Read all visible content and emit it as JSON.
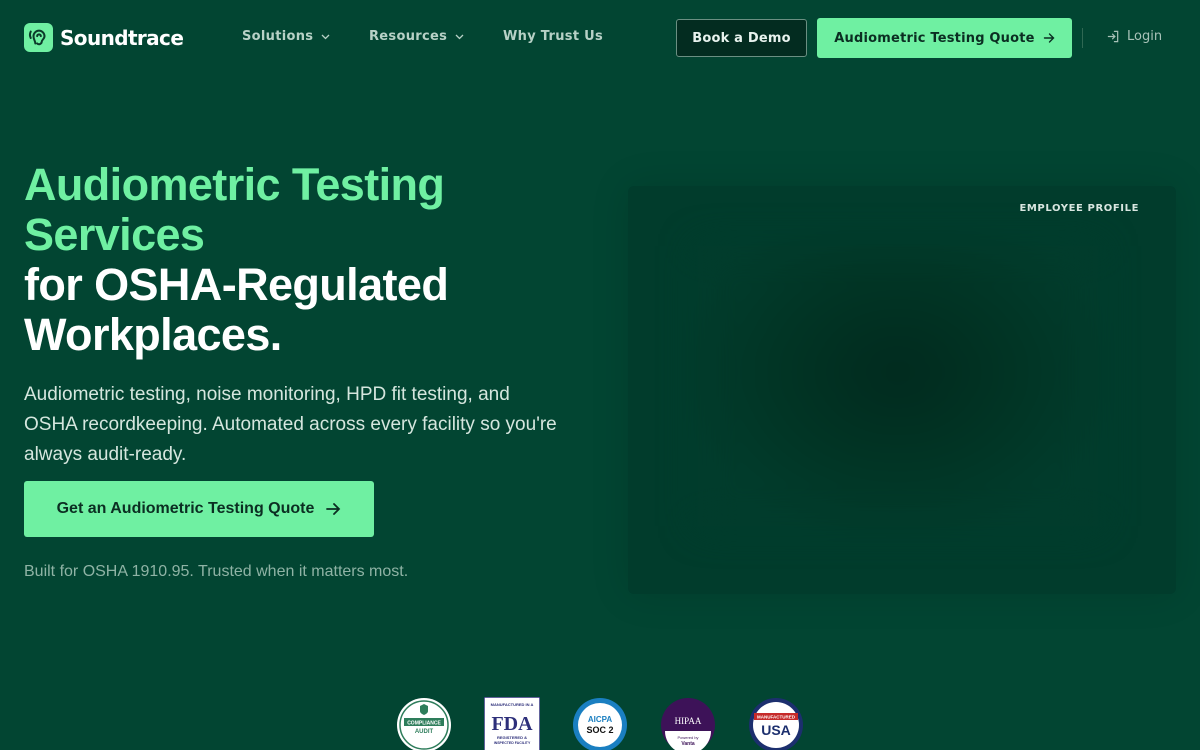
{
  "brand": {
    "name": "Soundtrace",
    "accent": "#6ff0a2",
    "background": "#024532"
  },
  "nav": {
    "links": [
      {
        "label": "Solutions",
        "has_dropdown": true
      },
      {
        "label": "Resources",
        "has_dropdown": true
      },
      {
        "label": "Why Trust Us",
        "has_dropdown": false
      }
    ],
    "demo_label": "Book a Demo",
    "quote_label": "Audiometric Testing Quote",
    "login_label": "Login"
  },
  "hero": {
    "headline_green": [
      "Audiometric Testing",
      "Services"
    ],
    "headline_white": [
      "for OSHA-Regulated",
      "Workplaces."
    ],
    "subtext": "Audiometric testing, noise monitoring, HPD fit testing, and OSHA recordkeeping. Automated across every facility so you're always audit-ready.",
    "cta_label": "Get an Audiometric Testing Quote",
    "tagline": "Built for OSHA 1910.95. Trusted when it matters most."
  },
  "profile_panel": {
    "label": "EMPLOYEE PROFILE"
  },
  "badges": [
    {
      "name": "compliance-audit-badge",
      "text": [
        "COMPLIANCE",
        "AUDIT"
      ]
    },
    {
      "name": "fda-badge",
      "text": [
        "MANUFACTURED IN A",
        "FDA",
        "REGISTERED &",
        "INSPECTED FACILITY"
      ]
    },
    {
      "name": "soc2-badge",
      "text": [
        "AICPA",
        "SOC 2"
      ]
    },
    {
      "name": "hipaa-badge",
      "text": [
        "HIPAA",
        "Powered by",
        "Vanta"
      ]
    },
    {
      "name": "usa-badge",
      "text": [
        "MANUFACTURED",
        "USA"
      ]
    }
  ]
}
